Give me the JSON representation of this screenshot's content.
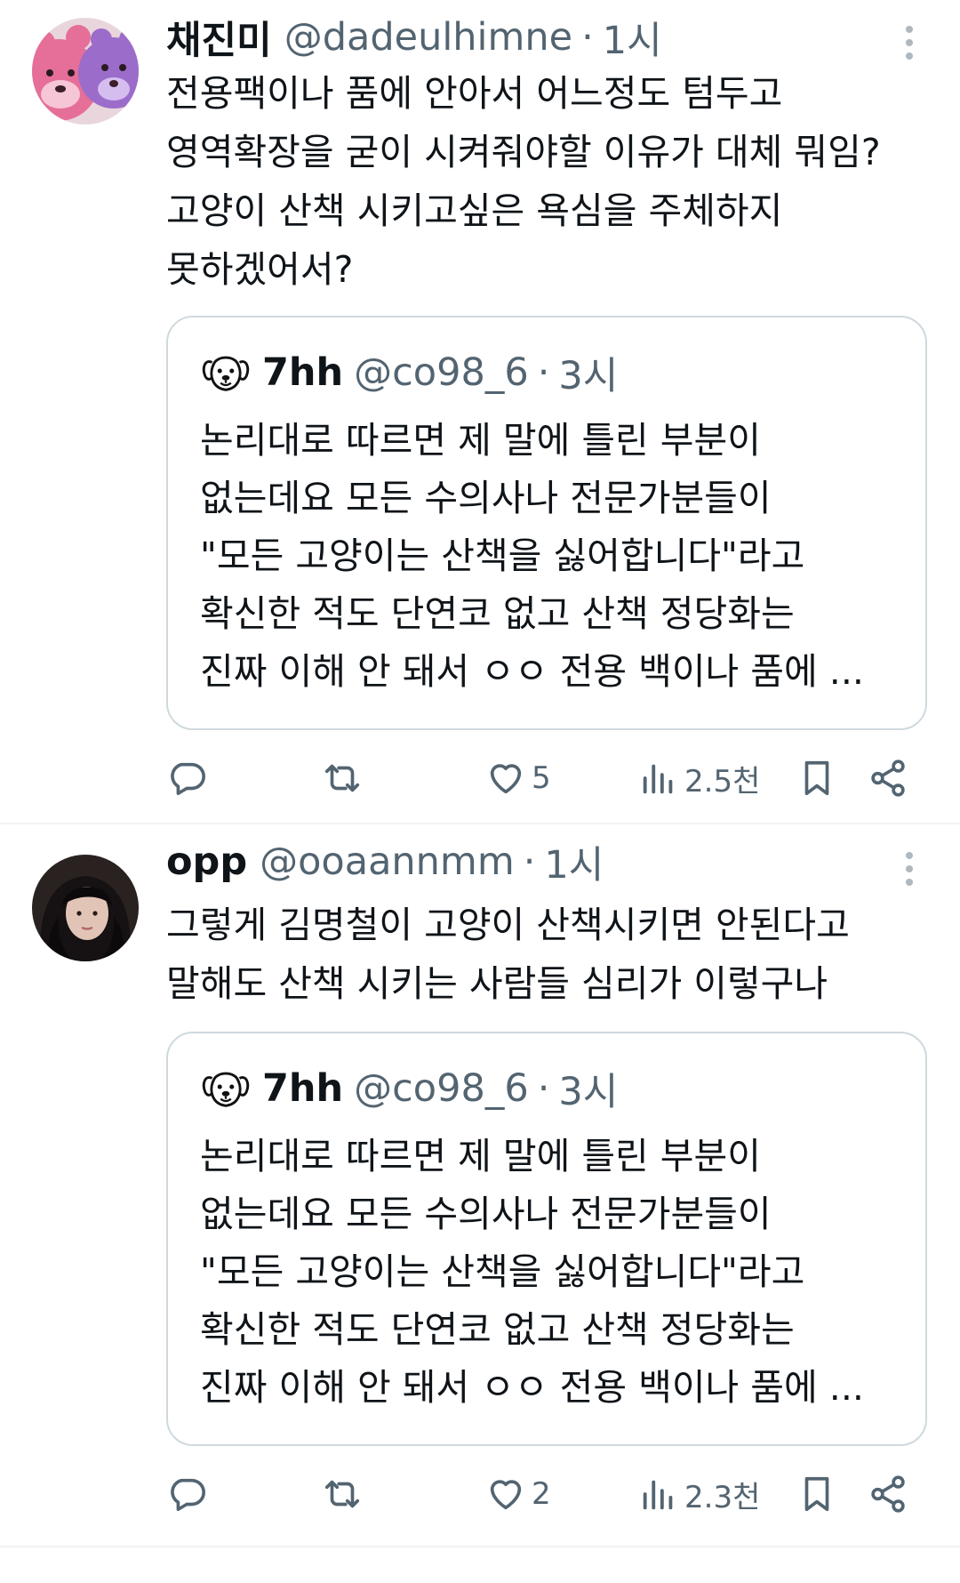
{
  "tweets": [
    {
      "display_name": "채진미",
      "handle": "@dadeulhimne",
      "separator": "·",
      "time": "1시",
      "avatar_icon": "pink-and-purple-bear-plush-avatar",
      "text": "전용팩이나 품에 안아서 어느정도 텀두고\n영역확장을 굳이 시켜줘야할 이유가 대체 뭐임?\n고양이 산책 시키고싶은 욕심을 주체하지\n못하겠어서?",
      "quote": {
        "display_name": "7hh",
        "handle": "@co98_6",
        "separator": "·",
        "time": "3시",
        "avatar_icon": "dog-face-icon",
        "text": "논리대로 따르면 제 말에 틀린 부분이\n없는데요 모든 수의사나 전문가분들이\n\"모든 고양이는 산책을 싫어합니다\"라고\n확신한 적도 단연코 없고 산책 정당화는\n진짜 이해 안 돼서 ㅇㅇ 전용 백이나 품에 ..."
      },
      "stats": {
        "replies": "",
        "retweets": "",
        "likes": "5",
        "views": "2.5천"
      }
    },
    {
      "display_name": "opp",
      "handle": "@ooaannmm",
      "separator": "·",
      "time": "1시",
      "avatar_icon": "dark-haired-person-avatar",
      "text": "그렇게 김명철이 고양이 산책시키면 안된다고\n말해도 산책 시키는 사람들 심리가 이렇구나",
      "quote": {
        "display_name": "7hh",
        "handle": "@co98_6",
        "separator": "·",
        "time": "3시",
        "avatar_icon": "dog-face-icon",
        "text": "논리대로 따르면 제 말에 틀린 부분이\n없는데요 모든 수의사나 전문가분들이\n\"모든 고양이는 산책을 싫어합니다\"라고\n확신한 적도 단연코 없고 산책 정당화는\n진짜 이해 안 돼서 ㅇㅇ 전용 백이나 품에 ..."
      },
      "stats": {
        "replies": "",
        "retweets": "",
        "likes": "2",
        "views": "2.3천"
      }
    }
  ],
  "colors": {
    "text_primary": "#0f1419",
    "text_secondary": "#536471",
    "border": "#cfd9de",
    "divider": "#eff3f4"
  }
}
